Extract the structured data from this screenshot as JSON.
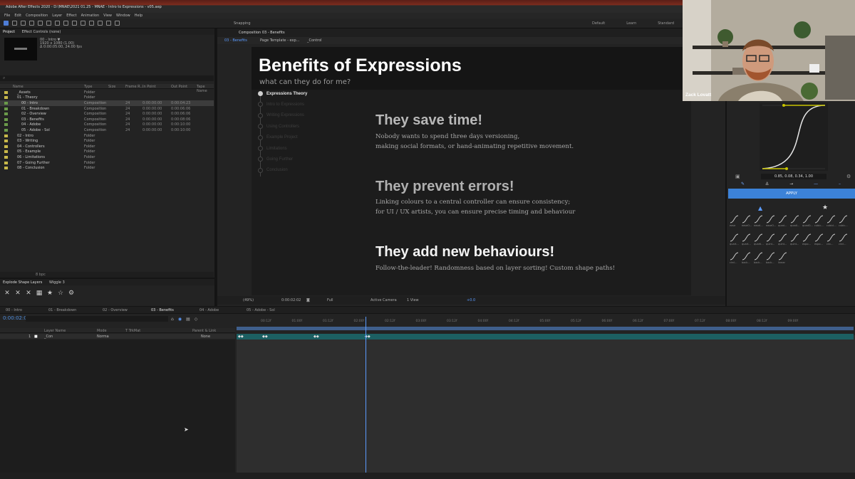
{
  "app": {
    "title": "Adobe After Effects 2020 - D:\\MNAE\\2021 01.25 - MNAE - Intro to Expressions - v05.aep",
    "menu": [
      "File",
      "Edit",
      "Composition",
      "Layer",
      "Effect",
      "Animation",
      "View",
      "Window",
      "Help"
    ],
    "workspaces": [
      "Default",
      "Learn",
      "Standard"
    ],
    "snapping_label": "Snapping"
  },
  "project": {
    "tabs": [
      "Project",
      "Effect Controls (none)"
    ],
    "selected_name": "00 - Intro ▼",
    "selected_info": [
      "1920 x 1080 (1.00)",
      "Δ 0:00:05:00, 24.00 fps"
    ],
    "columns": [
      "Name",
      "Type",
      "Size",
      "Frame R...",
      "In Point",
      "Out Point",
      "Tape Name"
    ],
    "rows": [
      {
        "name": "_Assets",
        "type": "Folder",
        "swatch": "#c8b84a",
        "indent": 0
      },
      {
        "name": "01 - Theory",
        "type": "Folder",
        "swatch": "#c8b84a",
        "indent": 0
      },
      {
        "name": "00 - Intro",
        "type": "Composition",
        "fps": "24",
        "in": "0:00:00:00",
        "out": "0:00:04:23",
        "swatch": "#6a9a4a",
        "indent": 1,
        "selected": true
      },
      {
        "name": "01 - Breakdown",
        "type": "Composition",
        "fps": "24",
        "in": "0:00:00:00",
        "out": "0:00:06:06",
        "swatch": "#6a9a4a",
        "indent": 1
      },
      {
        "name": "02 - Overview",
        "type": "Composition",
        "fps": "24",
        "in": "0:00:00:00",
        "out": "0:00:06:06",
        "swatch": "#6a9a4a",
        "indent": 1
      },
      {
        "name": "03 - Benefits",
        "type": "Composition",
        "fps": "24",
        "in": "0:00:00:00",
        "out": "0:00:08:06",
        "swatch": "#6a9a4a",
        "indent": 1
      },
      {
        "name": "04 - Adobe",
        "type": "Composition",
        "fps": "24",
        "in": "0:00:00:00",
        "out": "0:00:10:00",
        "swatch": "#6a9a4a",
        "indent": 1
      },
      {
        "name": "05 - Adobe - Sol",
        "type": "Composition",
        "fps": "24",
        "in": "0:00:00:00",
        "out": "0:00:10:00",
        "swatch": "#6a9a4a",
        "indent": 1
      },
      {
        "name": "02 - Intro",
        "type": "Folder",
        "swatch": "#c8b84a",
        "indent": 0
      },
      {
        "name": "03 - Writing",
        "type": "Folder",
        "swatch": "#c8b84a",
        "indent": 0
      },
      {
        "name": "04 - Controllers",
        "type": "Folder",
        "swatch": "#c8b84a",
        "indent": 0
      },
      {
        "name": "05 - Example",
        "type": "Folder",
        "swatch": "#c8b84a",
        "indent": 0
      },
      {
        "name": "06 - Limitations",
        "type": "Folder",
        "swatch": "#c8b84a",
        "indent": 0
      },
      {
        "name": "07 - Going Further",
        "type": "Folder",
        "swatch": "#c8b84a",
        "indent": 0
      },
      {
        "name": "08 - Conclusion",
        "type": "Folder",
        "swatch": "#c8b84a",
        "indent": 0
      }
    ],
    "footer_label": "8 bpc"
  },
  "effects_panel": {
    "tabs": [
      "Explode Shape Layers",
      "Wiggle 3"
    ]
  },
  "composition": {
    "tab": "Composition 03 - Benefits",
    "subtabs": [
      "03 - Benefits",
      "Page Template - exp...",
      "_Control"
    ],
    "slide": {
      "title": "Benefits of Expressions",
      "subtitle": "what can they do for me?",
      "nav": [
        {
          "label": "Expressions Theory",
          "active": true
        },
        {
          "label": "Intro to Expressions",
          "active": false
        },
        {
          "label": "Writing Expressions",
          "active": false
        },
        {
          "label": "Using Controllers",
          "active": false
        },
        {
          "label": "Example Project",
          "active": false
        },
        {
          "label": "Limitations",
          "active": false
        },
        {
          "label": "Going Further",
          "active": false
        },
        {
          "label": "Conclusion",
          "active": false
        }
      ],
      "benefits": [
        {
          "heading": "They save time!",
          "color": "#b8b8b8",
          "lines": [
            "Nobody wants to spend three days versioning,",
            "making social formats, or hand-animating repetitive movement."
          ]
        },
        {
          "heading": "They prevent errors!",
          "color": "#b0b0b0",
          "lines": [
            "Linking colours to a central controller can ensure consistency;",
            "for UI / UX artists, you can ensure precise timing and behaviour"
          ]
        },
        {
          "heading": "They add new behaviours!",
          "color": "#f4f4f4",
          "lines": [
            "Follow-the-leader! Randomness based on layer sorting! Custom shape paths!"
          ]
        }
      ]
    },
    "viewer_bar": {
      "zoom": "(49%)",
      "timecode": "0:00:02:02",
      "resolution": "Full",
      "camera": "Active Camera",
      "views": "1 View",
      "exposure": "+0.0"
    }
  },
  "flow_panel": {
    "curve_value": "0.85, 0.08, 0.34, 1.00",
    "apply_label": "APPLY",
    "presets_row1": [
      "ease",
      "easeO...",
      "easeI...",
      "easeO...",
      "quad...",
      "quadI...",
      "quadO...",
      "cubic...",
      "cubicI...",
      "cubic..."
    ],
    "presets_row2": [
      "quart...",
      "quart...",
      "quarti...",
      "quint...",
      "quint...",
      "quint...",
      "expo...",
      "expo...",
      "circ...",
      "circl..."
    ],
    "presets_row3": [
      "circl...",
      "back...",
      "back...",
      "back...",
      "linear"
    ]
  },
  "webcam": {
    "name": "Zack Lovatt"
  },
  "timeline": {
    "tabs": [
      "00 - Intro",
      "01 - Breakdown",
      "02 - Overview",
      "03 - Benefits",
      "04 - Adobe",
      "05 - Adobe - Sol"
    ],
    "active_tab": "03 - Benefits",
    "current_time": "0:00:02:02",
    "columns": [
      "Layer Name",
      "Mode",
      "T TrkMat",
      "Parent & Link"
    ],
    "layer": {
      "num": "1",
      "name": "_Con",
      "mode": "Norma",
      "parent": "None"
    },
    "ruler": [
      "00:12f",
      "01:00f",
      "01:12f",
      "02:00f",
      "02:12f",
      "03:00f",
      "03:12f",
      "04:00f",
      "04:12f",
      "05:00f",
      "05:12f",
      "06:00f",
      "06:12f",
      "07:00f",
      "07:12f",
      "08:00f",
      "08:12f",
      "09:00f"
    ]
  }
}
